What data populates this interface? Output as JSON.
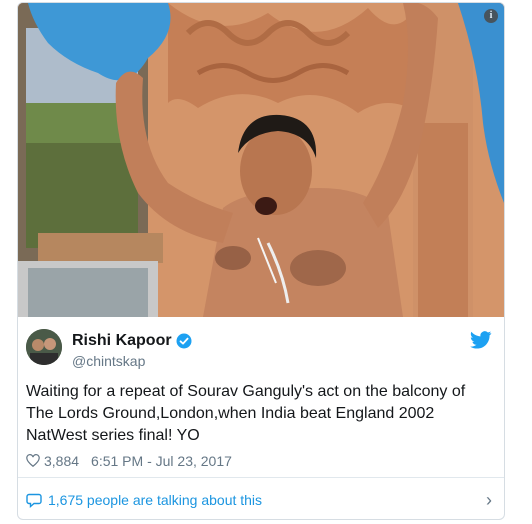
{
  "tweet": {
    "author_name": "Rishi Kapoor",
    "author_handle": "@chintskap",
    "text": "Waiting for a repeat of Sourav Ganguly's act on the balcony of The Lords Ground,London,when India beat England 2002 NatWest series final! YO",
    "likes": "3,884",
    "timestamp": "6:51 PM - Jul 23, 2017",
    "talking": "1,675 people are talking about this"
  },
  "icons": {
    "info": "info-icon",
    "verified": "verified-badge-icon",
    "twitter": "twitter-bird-icon",
    "like": "heart-icon",
    "reply": "speech-bubble-icon",
    "more": "chevron-right-icon"
  },
  "colors": {
    "brand_blue": "#1da1f2",
    "link_blue": "#1b95e0",
    "secondary_text": "#657786",
    "primary_text": "#14171a"
  }
}
